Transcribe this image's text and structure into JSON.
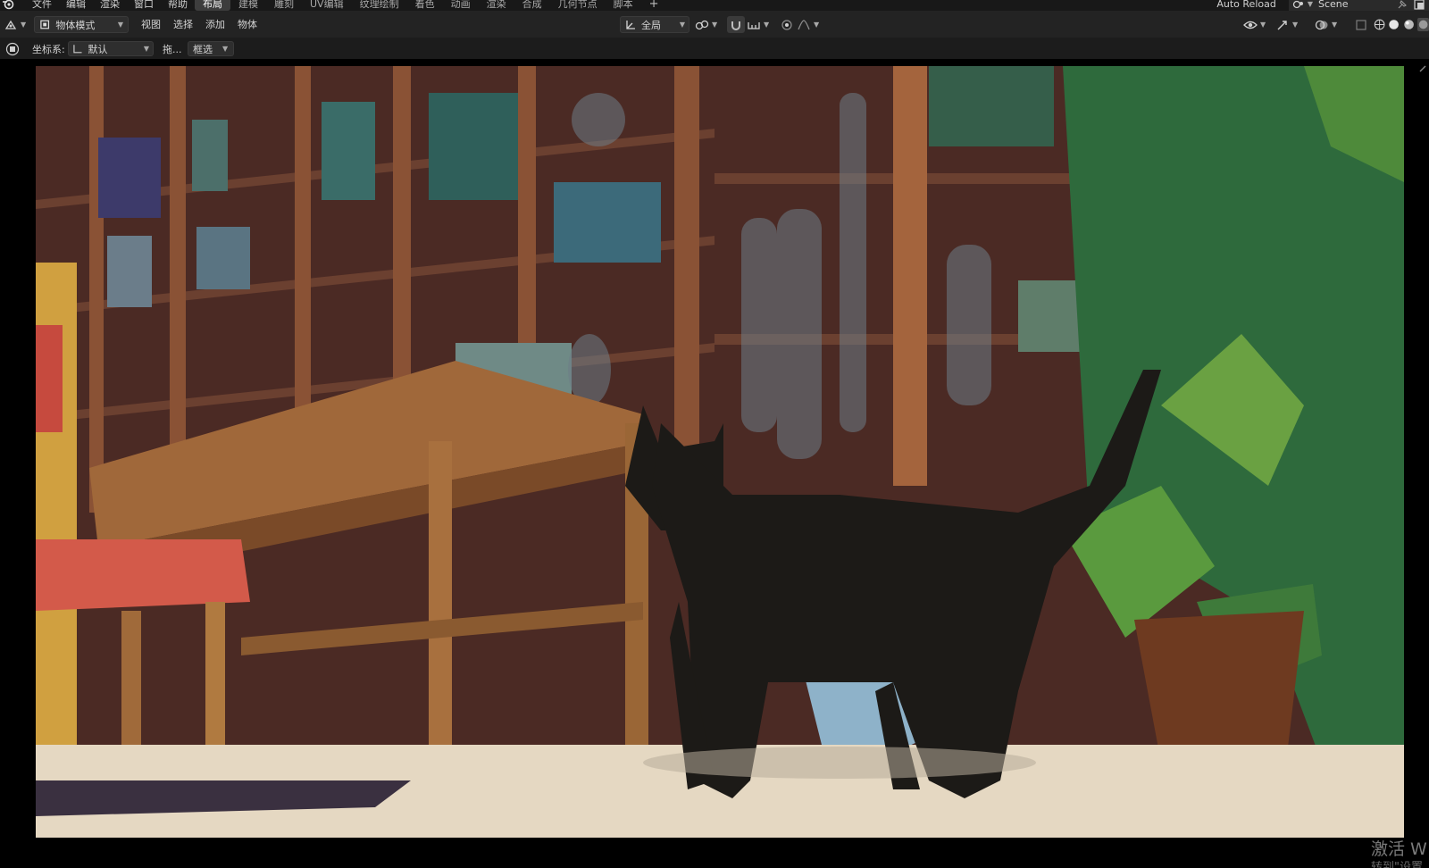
{
  "menubar": {
    "logo": "blender-logo-icon",
    "items": [
      "文件",
      "编辑",
      "渲染",
      "窗口",
      "帮助"
    ],
    "workspaces": [
      "布局",
      "建模",
      "雕刻",
      "UV编辑",
      "纹理绘制",
      "着色",
      "动画",
      "渲染",
      "合成",
      "几何节点",
      "脚本"
    ],
    "active_workspace": "布局",
    "add_workspace": "+",
    "auto_reload": "Auto Reload",
    "scene_name": "Scene"
  },
  "header": {
    "mode": "物体模式",
    "menus": [
      "视图",
      "选择",
      "添加",
      "物体"
    ],
    "transform_orientation": "全局"
  },
  "tool_settings": {
    "coord_label": "坐标系:",
    "coord_value": "默认",
    "drag_label": "拖...",
    "select_mode": "框选"
  },
  "viewport": {
    "watermark_line1": "激活 W",
    "watermark_line2": "转到\"设置"
  },
  "colors": {
    "ui_bg": "#232323",
    "menubar_bg": "#181818",
    "viewport_bg": "#000000",
    "accent_active": "#3d3d3d"
  }
}
